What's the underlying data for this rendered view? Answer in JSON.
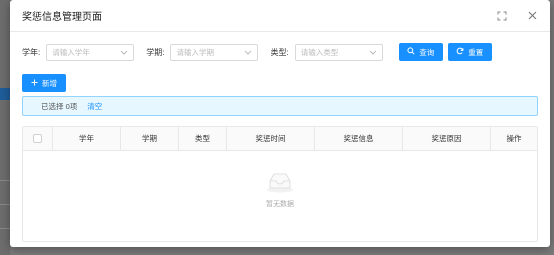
{
  "dialog": {
    "title": "奖惩信息管理页面"
  },
  "filters": {
    "year": {
      "label": "学年:",
      "placeholder": "请输入学年"
    },
    "term": {
      "label": "学期:",
      "placeholder": "请输入学期"
    },
    "type": {
      "label": "类型:",
      "placeholder": "请输入类型"
    },
    "query_label": "查询",
    "reset_label": "重置"
  },
  "toolbar": {
    "add_label": "新增"
  },
  "selection": {
    "text": "已选择 0项",
    "clear_label": "清空"
  },
  "table": {
    "columns": [
      "学年",
      "学期",
      "类型",
      "奖惩时间",
      "奖惩信息",
      "奖惩原因",
      "操作"
    ],
    "empty_text": "暂无数据"
  },
  "colors": {
    "primary": "#1890ff",
    "alert_bg": "#e6f7ff"
  }
}
